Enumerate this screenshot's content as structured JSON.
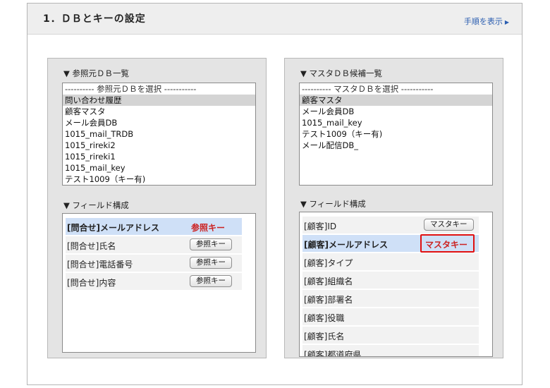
{
  "header": {
    "title": "1．ＤＢとキーの設定",
    "show_steps": "手順を表示"
  },
  "left_panel": {
    "source_label": "▼ 参照元ＤＢ一覧",
    "source_placeholder": "---------- 参照元ＤＢを選択 -----------",
    "source_options": [
      "問い合わせ履歴",
      "顧客マスタ",
      "メール会員DB",
      "1015_mail_TRDB",
      "1015_rireki2",
      "1015_rireki1",
      "1015_mail_key",
      "テスト1009（キー有)"
    ],
    "selected_index": 0,
    "field_label": "▼ フィールド構成",
    "fields": [
      {
        "name": "[問合せ]メールアドレス",
        "key": "参照キー",
        "active": true
      },
      {
        "name": "[問合せ]氏名",
        "key": "参照キー",
        "active": false
      },
      {
        "name": "[問合せ]電話番号",
        "key": "参照キー",
        "active": false
      },
      {
        "name": "[問合せ]内容",
        "key": "参照キー",
        "active": false
      }
    ]
  },
  "right_panel": {
    "master_label": "▼ マスタＤＢ候補一覧",
    "master_placeholder": "---------- マスタＤＢを選択 -----------",
    "master_options": [
      "顧客マスタ",
      "メール会員DB",
      "1015_mail_key",
      "テスト1009（キー有)",
      "メール配信DB_"
    ],
    "selected_index": 0,
    "field_label": "▼ フィールド構成",
    "fields": [
      {
        "name": "[顧客]ID",
        "key": "マスタキー",
        "button": true,
        "active": false
      },
      {
        "name": "[顧客]メールアドレス",
        "key": "マスタキー",
        "button": false,
        "active": true
      },
      {
        "name": "[顧客]タイプ",
        "key": "",
        "button": false,
        "active": false
      },
      {
        "name": "[顧客]組織名",
        "key": "",
        "button": false,
        "active": false
      },
      {
        "name": "[顧客]部署名",
        "key": "",
        "button": false,
        "active": false
      },
      {
        "name": "[顧客]役職",
        "key": "",
        "button": false,
        "active": false
      },
      {
        "name": "[顧客]氏名",
        "key": "",
        "button": false,
        "active": false
      },
      {
        "name": "[顧客]都道府県",
        "key": "",
        "button": false,
        "active": false
      }
    ]
  },
  "colors": {
    "header_bg": "#eeeeee",
    "panel_bg": "#e4e4e4",
    "highlight_row": "#cfe0f7",
    "key_red": "#cc2222",
    "outline_red": "#e01010",
    "link_blue": "#2a5db0"
  }
}
